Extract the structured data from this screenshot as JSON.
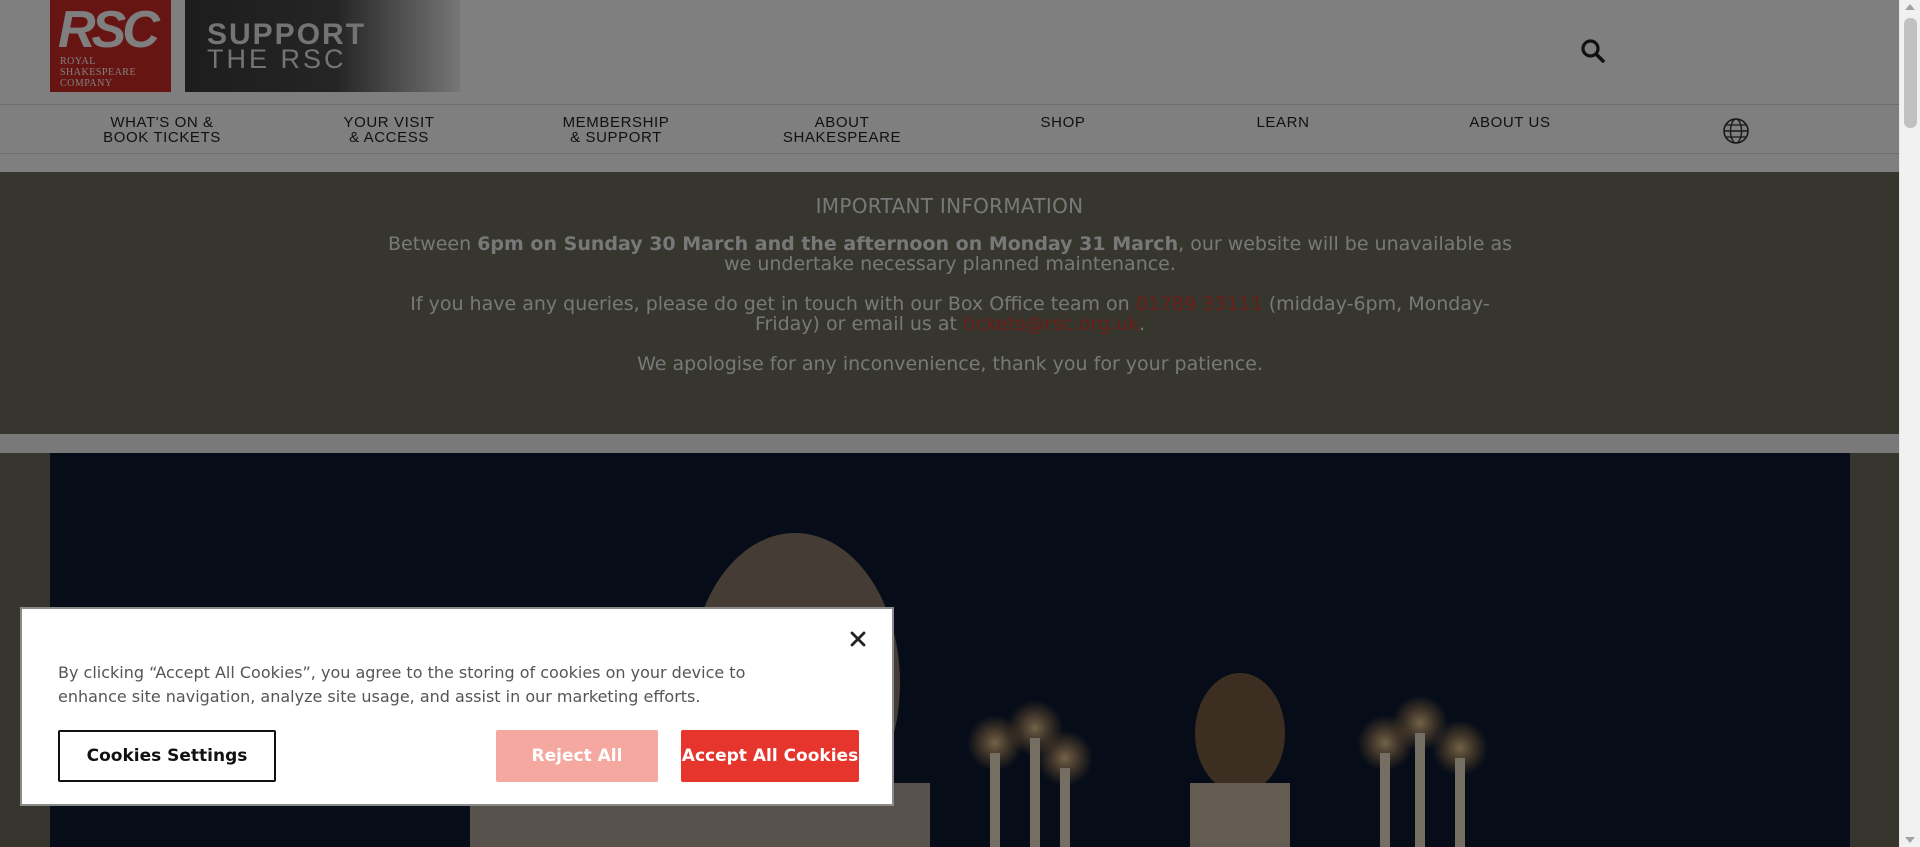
{
  "header": {
    "logo": {
      "main": "RSC",
      "sub_lines": [
        "ROYAL",
        "SHAKESPEARE",
        "COMPANY"
      ]
    },
    "support": {
      "line1": "SUPPORT",
      "line2": "THE RSC"
    },
    "search_icon": "search-icon"
  },
  "nav": {
    "items": [
      {
        "label": "WHAT'S ON &\nBOOK TICKETS"
      },
      {
        "label": "YOUR VISIT\n& ACCESS"
      },
      {
        "label": "MEMBERSHIP\n& SUPPORT"
      },
      {
        "label": "ABOUT\nSHAKESPEARE"
      },
      {
        "label": "SHOP"
      },
      {
        "label": "LEARN"
      },
      {
        "label": "ABOUT US"
      }
    ],
    "globe_icon": "globe-icon"
  },
  "notice": {
    "title": "IMPORTANT INFORMATION",
    "p1_pre": "Between ",
    "p1_bold": "6pm on Sunday 30 March and the afternoon on Monday 31 March",
    "p1_post": ", our website will be unavailable as we undertake necessary planned maintenance.",
    "p2_pre": "If you have any queries, please do get in touch with our Box Office team on ",
    "p2_phone": "01789 33111",
    "p2_mid": " (midday-6pm, Monday-Friday) or email us at ",
    "p2_email": "tickets@rsc.org.uk",
    "p2_post": ".",
    "p3": "We apologise for any inconvenience, thank you for your patience."
  },
  "cookie": {
    "text": "By clicking “Accept All Cookies”, you agree to the storing of cookies on your device to enhance site navigation, analyze site usage, and assist in our marketing efforts.",
    "settings_label": "Cookies Settings",
    "reject_label": "Reject All",
    "accept_label": "Accept All Cookies",
    "close_icon": "close-icon"
  },
  "colors": {
    "brand_red": "#cf2b25",
    "notice_bg": "#6c6d5d",
    "accept_red": "#e5352c",
    "reject_pink": "#f5a8a0"
  }
}
